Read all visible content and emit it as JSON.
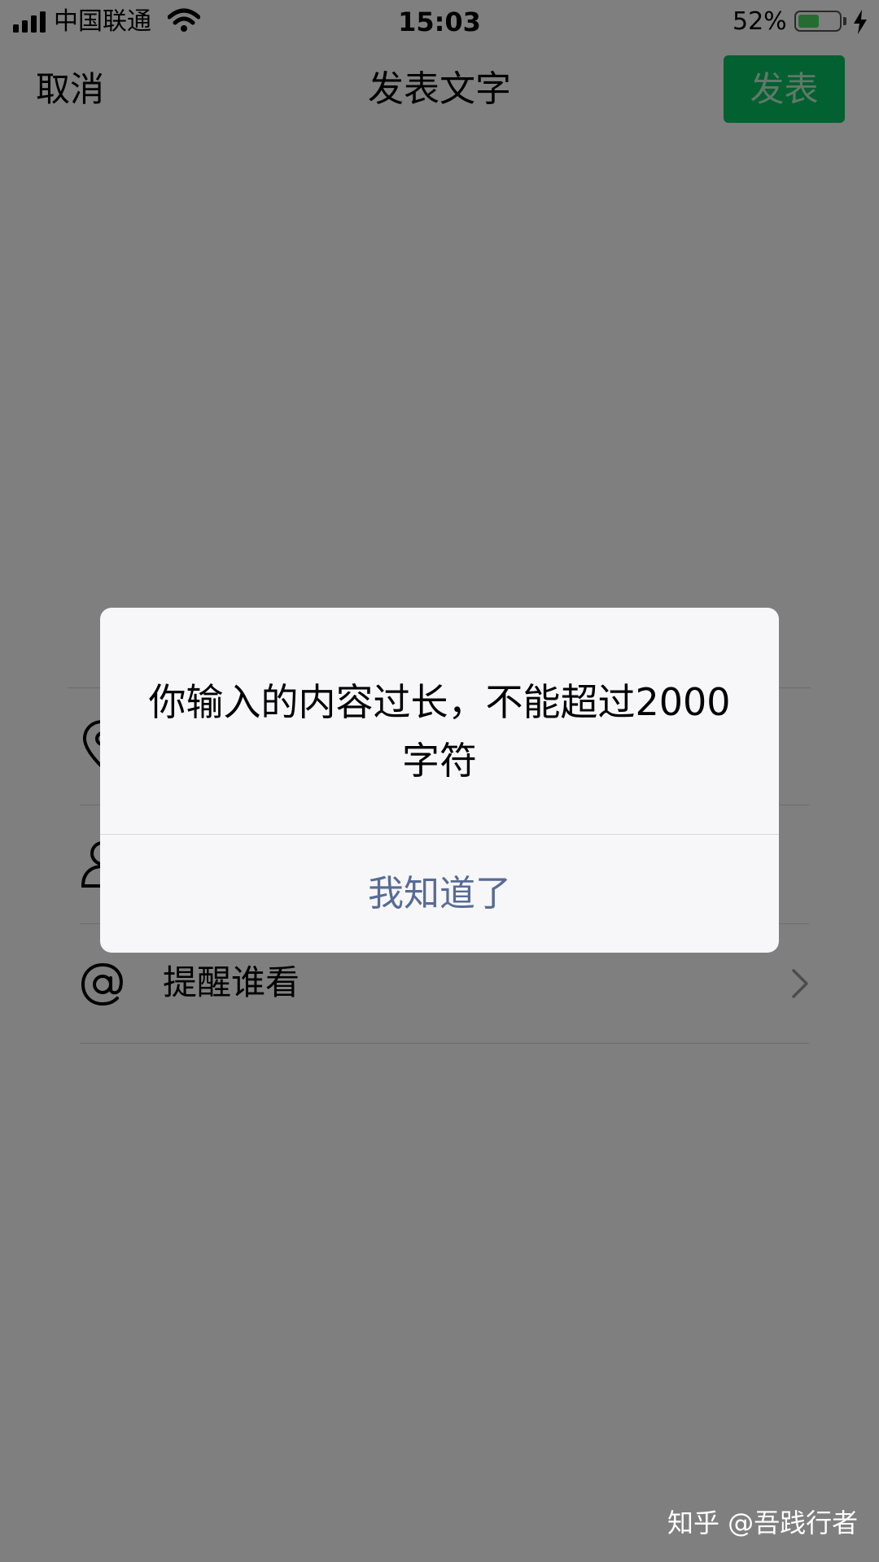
{
  "status_bar": {
    "carrier": "中国联通",
    "time": "15:03",
    "battery_percent": "52%",
    "battery_level": 0.52,
    "battery_color": "#4cd964"
  },
  "nav": {
    "cancel_label": "取消",
    "title": "发表文字",
    "publish_label": "发表",
    "publish_color": "#07c160"
  },
  "list": {
    "items": [
      {
        "icon": "location-pin-icon",
        "label": ""
      },
      {
        "icon": "person-icon",
        "label": ""
      },
      {
        "icon": "at-sign-icon",
        "label": "提醒谁看"
      }
    ]
  },
  "dialog": {
    "message": "你输入的内容过长，不能超过2000字符",
    "confirm_label": "我知道了",
    "confirm_color": "#576b95"
  },
  "watermark": "知乎 @吾践行者"
}
